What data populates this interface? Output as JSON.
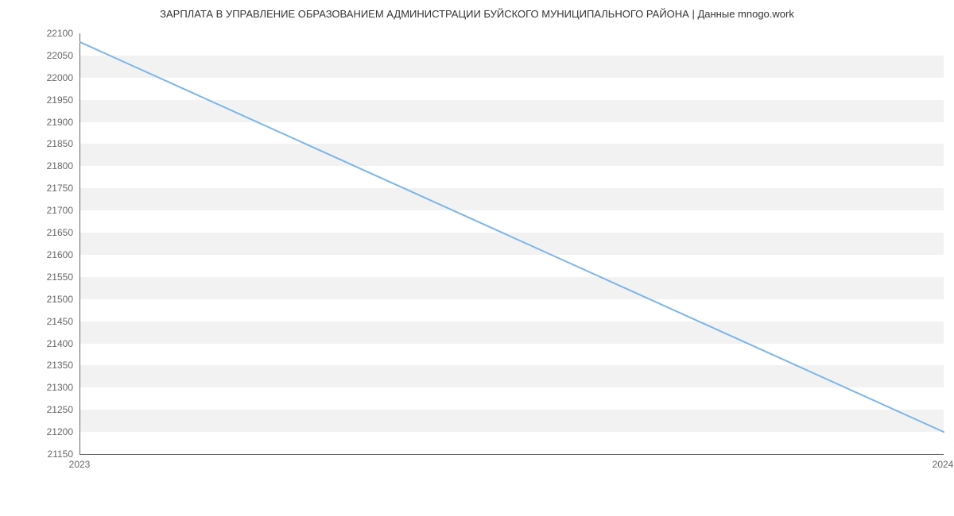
{
  "chart_data": {
    "type": "line",
    "title": "ЗАРПЛАТА В УПРАВЛЕНИЕ ОБРАЗОВАНИЕМ АДМИНИСТРАЦИИ БУЙСКОГО МУНИЦИПАЛЬНОГО РАЙОНА | Данные mnogo.work",
    "x": [
      "2023",
      "2024"
    ],
    "values": [
      22080,
      21200
    ],
    "xlabel": "",
    "ylabel": "",
    "ylim": [
      21150,
      22100
    ],
    "y_ticks": [
      21150,
      21200,
      21250,
      21300,
      21350,
      21400,
      21450,
      21500,
      21550,
      21600,
      21650,
      21700,
      21750,
      21800,
      21850,
      21900,
      21950,
      22000,
      22050,
      22100
    ],
    "x_ticks": [
      "2023",
      "2024"
    ],
    "line_color": "#7cb5ec",
    "band_color": "#f2f2f2",
    "grid": true
  }
}
